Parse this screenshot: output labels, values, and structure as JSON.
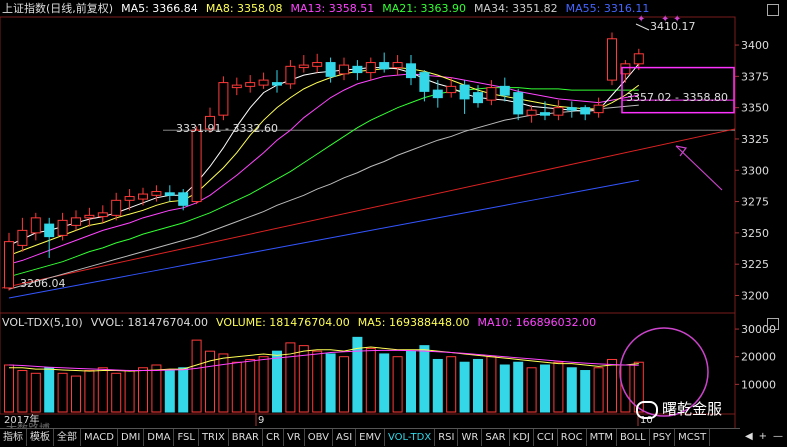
{
  "header": {
    "title": "上证指数(日线,前复权)",
    "ma5": "MA5: 3366.84",
    "ma8": "MA8: 3358.08",
    "ma13": "MA13: 3358.51",
    "ma21": "MA21: 3363.90",
    "ma34": "MA34: 3351.82",
    "ma55": "MA55: 3316.11"
  },
  "colors": {
    "up": "#ff3a3a",
    "down": "#33d7e8",
    "ma5": "#ffffff",
    "ma8": "#ffff55",
    "ma13": "#ff44ff",
    "ma21": "#33ff33",
    "ma34": "#bbbbbb",
    "ma55": "#3355ff",
    "box": "#ff33ff",
    "annotation": "#cc44cc"
  },
  "annotations": {
    "high_label": "3410.17",
    "box_label": "3357.02 - 3358.80",
    "support_label": "3331.91 - 3332.60",
    "low_label": "3206.04"
  },
  "axis": {
    "price_ticks": [
      "3400",
      "3375",
      "3350",
      "3325",
      "3300",
      "3275",
      "3250",
      "3225",
      "3200"
    ],
    "volume_ticks": [
      "30000",
      "20000",
      "10000"
    ],
    "month_labels": [
      "2017年",
      "9",
      "10"
    ]
  },
  "volume_header": {
    "name": "VOL-TDX(5,10)",
    "vvol": "VVOL: 181476704.00",
    "volume": "VOLUME: 181476704.00",
    "ma5": "MA5: 169388448.00",
    "ma10": "MA10: 166896032.00"
  },
  "tabs": {
    "left": [
      "指标",
      "模板",
      "全部"
    ],
    "items": [
      "MACD",
      "DMI",
      "DMA",
      "FSL",
      "TRIX",
      "BRAR",
      "CR",
      "VR",
      "OBV",
      "ASI",
      "EMV",
      "VOL-TDX",
      "RSI",
      "WR",
      "SAR",
      "KDJ",
      "CCI",
      "ROC",
      "MTM",
      "BOLL",
      "PSY",
      "MCST"
    ],
    "active": "VOL-TDX",
    "scroll": [
      "◀",
      "+",
      "—"
    ]
  },
  "watermark": "曙乾金服",
  "watermark2": "大数路博",
  "chart_data": {
    "type": "candlestick",
    "ylim": [
      3190,
      3420
    ],
    "candles": [
      {
        "o": 3206,
        "c": 3243,
        "h": 3250,
        "l": 3204
      },
      {
        "o": 3240,
        "c": 3252,
        "h": 3262,
        "l": 3235
      },
      {
        "o": 3250,
        "c": 3262,
        "h": 3266,
        "l": 3244
      },
      {
        "o": 3257,
        "c": 3247,
        "h": 3262,
        "l": 3230
      },
      {
        "o": 3248,
        "c": 3260,
        "h": 3266,
        "l": 3244
      },
      {
        "o": 3256,
        "c": 3262,
        "h": 3268,
        "l": 3252
      },
      {
        "o": 3262,
        "c": 3264,
        "h": 3270,
        "l": 3255
      },
      {
        "o": 3263,
        "c": 3266,
        "h": 3272,
        "l": 3258
      },
      {
        "o": 3264,
        "c": 3276,
        "h": 3282,
        "l": 3260
      },
      {
        "o": 3276,
        "c": 3279,
        "h": 3285,
        "l": 3268
      },
      {
        "o": 3277,
        "c": 3281,
        "h": 3286,
        "l": 3272
      },
      {
        "o": 3280,
        "c": 3283,
        "h": 3288,
        "l": 3275
      },
      {
        "o": 3282,
        "c": 3280,
        "h": 3288,
        "l": 3275
      },
      {
        "o": 3282,
        "c": 3272,
        "h": 3285,
        "l": 3268
      },
      {
        "o": 3275,
        "c": 3332,
        "h": 3335,
        "l": 3273
      },
      {
        "o": 3333,
        "c": 3343,
        "h": 3350,
        "l": 3330
      },
      {
        "o": 3344,
        "c": 3370,
        "h": 3375,
        "l": 3340
      },
      {
        "o": 3366,
        "c": 3368,
        "h": 3374,
        "l": 3360
      },
      {
        "o": 3367,
        "c": 3370,
        "h": 3376,
        "l": 3362
      },
      {
        "o": 3368,
        "c": 3372,
        "h": 3378,
        "l": 3365
      },
      {
        "o": 3370,
        "c": 3368,
        "h": 3380,
        "l": 3362
      },
      {
        "o": 3369,
        "c": 3383,
        "h": 3388,
        "l": 3365
      },
      {
        "o": 3382,
        "c": 3384,
        "h": 3392,
        "l": 3378
      },
      {
        "o": 3383,
        "c": 3386,
        "h": 3393,
        "l": 3378
      },
      {
        "o": 3386,
        "c": 3375,
        "h": 3390,
        "l": 3370
      },
      {
        "o": 3377,
        "c": 3384,
        "h": 3390,
        "l": 3372
      },
      {
        "o": 3383,
        "c": 3378,
        "h": 3388,
        "l": 3372
      },
      {
        "o": 3378,
        "c": 3386,
        "h": 3390,
        "l": 3372
      },
      {
        "o": 3386,
        "c": 3381,
        "h": 3394,
        "l": 3378
      },
      {
        "o": 3382,
        "c": 3386,
        "h": 3392,
        "l": 3376
      },
      {
        "o": 3385,
        "c": 3374,
        "h": 3392,
        "l": 3368
      },
      {
        "o": 3378,
        "c": 3363,
        "h": 3380,
        "l": 3355
      },
      {
        "o": 3364,
        "c": 3358,
        "h": 3372,
        "l": 3350
      },
      {
        "o": 3362,
        "c": 3367,
        "h": 3374,
        "l": 3358
      },
      {
        "o": 3368,
        "c": 3357,
        "h": 3372,
        "l": 3345
      },
      {
        "o": 3362,
        "c": 3354,
        "h": 3368,
        "l": 3350
      },
      {
        "o": 3356,
        "c": 3366,
        "h": 3372,
        "l": 3352
      },
      {
        "o": 3367,
        "c": 3360,
        "h": 3374,
        "l": 3355
      },
      {
        "o": 3362,
        "c": 3345,
        "h": 3365,
        "l": 3340
      },
      {
        "o": 3344,
        "c": 3348,
        "h": 3352,
        "l": 3338
      },
      {
        "o": 3346,
        "c": 3344,
        "h": 3355,
        "l": 3340
      },
      {
        "o": 3344,
        "c": 3350,
        "h": 3356,
        "l": 3340
      },
      {
        "o": 3350,
        "c": 3348,
        "h": 3355,
        "l": 3342
      },
      {
        "o": 3350,
        "c": 3345,
        "h": 3352,
        "l": 3340
      },
      {
        "o": 3346,
        "c": 3352,
        "h": 3358,
        "l": 3342
      },
      {
        "o": 3372,
        "c": 3405,
        "h": 3410,
        "l": 3368
      },
      {
        "o": 3377,
        "c": 3385,
        "h": 3388,
        "l": 3370
      },
      {
        "o": 3385,
        "c": 3393,
        "h": 3397,
        "l": 3380
      }
    ],
    "volume_up_down": "01011010101101001011010110011010110011000100110011010100",
    "volumes": [
      17000,
      15000,
      14000,
      16000,
      14000,
      13000,
      15000,
      16000,
      14000,
      15000,
      16000,
      17000,
      15000,
      16000,
      26000,
      22000,
      21000,
      18000,
      19000,
      20000,
      22000,
      25000,
      24000,
      22000,
      21000,
      20000,
      27000,
      23000,
      21000,
      20000,
      22000,
      24000,
      19000,
      20000,
      18000,
      19000,
      20000,
      17000,
      18000,
      16000,
      17000,
      18000,
      16000,
      15000,
      16000,
      19000,
      17000,
      18000
    ],
    "ma_lines": {
      "ma5": [
        3240,
        3245,
        3250,
        3252,
        3255,
        3258,
        3261,
        3263,
        3266,
        3270,
        3274,
        3278,
        3280,
        3280,
        3290,
        3303,
        3318,
        3335,
        3350,
        3362,
        3368,
        3372,
        3376,
        3378,
        3379,
        3380,
        3381,
        3382,
        3382,
        3381,
        3378,
        3373,
        3369,
        3366,
        3361,
        3358,
        3357,
        3356,
        3354,
        3351,
        3350,
        3349,
        3348,
        3347,
        3348,
        3360,
        3372,
        3385
      ],
      "ma8": [
        3232,
        3236,
        3240,
        3244,
        3248,
        3252,
        3256,
        3258,
        3262,
        3265,
        3268,
        3272,
        3275,
        3276,
        3282,
        3292,
        3302,
        3314,
        3328,
        3340,
        3350,
        3358,
        3365,
        3370,
        3374,
        3377,
        3379,
        3380,
        3381,
        3382,
        3381,
        3379,
        3376,
        3372,
        3368,
        3364,
        3361,
        3359,
        3357,
        3355,
        3353,
        3351,
        3350,
        3349,
        3349,
        3354,
        3360,
        3368
      ],
      "ma13": [
        3225,
        3228,
        3232,
        3236,
        3240,
        3244,
        3248,
        3252,
        3255,
        3258,
        3262,
        3265,
        3268,
        3270,
        3274,
        3280,
        3288,
        3296,
        3305,
        3314,
        3324,
        3332,
        3342,
        3350,
        3358,
        3364,
        3369,
        3372,
        3375,
        3376,
        3377,
        3376,
        3375,
        3374,
        3372,
        3370,
        3368,
        3366,
        3363,
        3361,
        3359,
        3357,
        3356,
        3355,
        3354,
        3356,
        3358,
        3360
      ],
      "ma21": [
        3215,
        3218,
        3221,
        3224,
        3227,
        3231,
        3235,
        3238,
        3242,
        3245,
        3249,
        3252,
        3255,
        3258,
        3262,
        3266,
        3271,
        3276,
        3281,
        3287,
        3293,
        3299,
        3306,
        3313,
        3320,
        3327,
        3334,
        3340,
        3345,
        3350,
        3354,
        3358,
        3361,
        3363,
        3364,
        3365,
        3366,
        3366,
        3366,
        3365,
        3365,
        3365,
        3364,
        3364,
        3364,
        3364,
        3364,
        3364
      ],
      "ma34": [
        3205,
        3208,
        3211,
        3214,
        3217,
        3220,
        3223,
        3226,
        3229,
        3232,
        3235,
        3238,
        3241,
        3244,
        3247,
        3251,
        3255,
        3259,
        3263,
        3267,
        3272,
        3276,
        3280,
        3285,
        3289,
        3294,
        3298,
        3303,
        3307,
        3312,
        3316,
        3320,
        3324,
        3327,
        3331,
        3334,
        3337,
        3340,
        3342,
        3344,
        3345,
        3346,
        3347,
        3348,
        3349,
        3350,
        3351,
        3352
      ],
      "ma55": [
        3198,
        3200,
        3202,
        3204,
        3206,
        3208,
        3210,
        3212,
        3214,
        3216,
        3218,
        3220,
        3222,
        3224,
        3226,
        3228,
        3230,
        3232,
        3234,
        3236,
        3238,
        3240,
        3242,
        3244,
        3246,
        3248,
        3250,
        3252,
        3254,
        3256,
        3258,
        3260,
        3262,
        3264,
        3266,
        3268,
        3270,
        3272,
        3274,
        3276,
        3278,
        3280,
        3282,
        3284,
        3286,
        3288,
        3290,
        3292
      ]
    },
    "volume_ma": {
      "ma5": [
        16000,
        16000,
        15500,
        15500,
        15200,
        15000,
        14800,
        15000,
        15000,
        14800,
        15000,
        15200,
        15500,
        15500,
        17000,
        18500,
        19500,
        20000,
        20500,
        21000,
        20500,
        21000,
        22000,
        22500,
        22500,
        22000,
        23000,
        23500,
        23000,
        22500,
        22500,
        22500,
        22000,
        21500,
        21000,
        20500,
        20000,
        19500,
        19000,
        18500,
        18000,
        17500,
        17500,
        17000,
        16500,
        17000,
        17000,
        17500
      ],
      "ma10": [
        17000,
        16800,
        16500,
        16200,
        16000,
        15800,
        15600,
        15400,
        15200,
        15000,
        15000,
        15000,
        15200,
        15300,
        15800,
        16500,
        17200,
        17800,
        18400,
        19000,
        19500,
        20000,
        20500,
        21000,
        21500,
        21800,
        22000,
        22200,
        22300,
        22300,
        22200,
        22000,
        21800,
        21500,
        21200,
        20800,
        20400,
        20000,
        19600,
        19200,
        18800,
        18400,
        18000,
        17700,
        17400,
        17200,
        17000,
        16900
      ]
    }
  }
}
